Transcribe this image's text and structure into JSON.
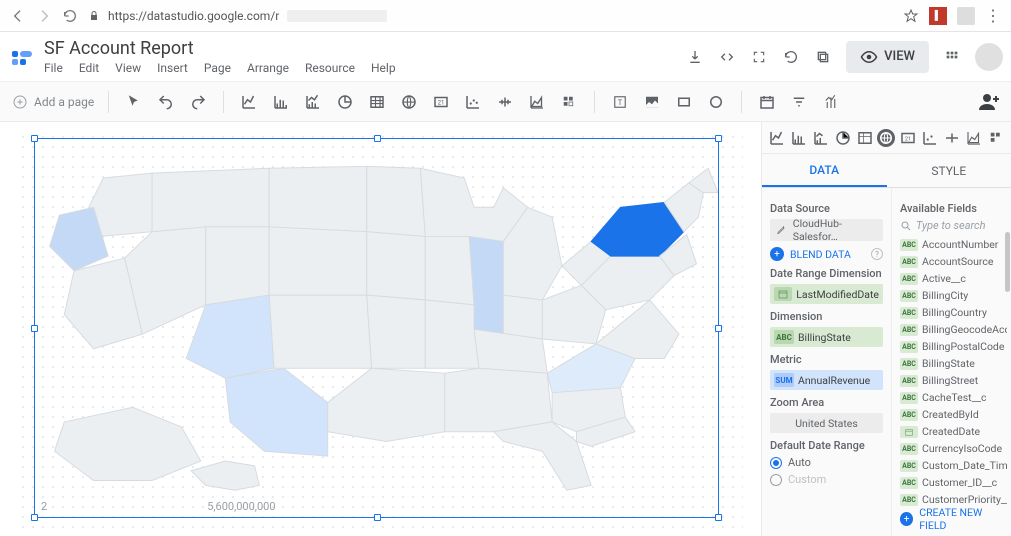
{
  "browser": {
    "url": "https://datastudio.google.com/r"
  },
  "header": {
    "title": "SF Account Report",
    "menus": [
      "File",
      "Edit",
      "View",
      "Insert",
      "Page",
      "Arrange",
      "Resource",
      "Help"
    ],
    "view_label": "VIEW"
  },
  "toolbar": {
    "add_page": "Add a page"
  },
  "canvas": {
    "footer_left": "2",
    "footer_value": "5,600,000,000"
  },
  "panel": {
    "tabs": {
      "data": "DATA",
      "style": "STYLE"
    },
    "sections": {
      "data_source": "Data Source",
      "date_range_dim": "Date Range Dimension",
      "dimension": "Dimension",
      "metric": "Metric",
      "zoom_area": "Zoom Area",
      "default_date_range": "Default Date Range",
      "available_fields": "Available Fields"
    },
    "data_source_chip": "CloudHub-Salesfor…",
    "blend": "BLEND DATA",
    "date_range_chip": "LastModifiedDate",
    "dimension_chip": "BillingState",
    "metric_chip": "AnnualRevenue",
    "metric_badge": "SUM",
    "zoom_chip": "United States",
    "radio_auto": "Auto",
    "radio_custom": "Custom",
    "search_placeholder": "Type to search",
    "fields": [
      {
        "t": "abc",
        "n": "AccountNumber"
      },
      {
        "t": "abc",
        "n": "AccountSource"
      },
      {
        "t": "abc",
        "n": "Active__c"
      },
      {
        "t": "abc",
        "n": "BillingCity"
      },
      {
        "t": "abc",
        "n": "BillingCountry"
      },
      {
        "t": "abc",
        "n": "BillingGeocodeAccura…"
      },
      {
        "t": "abc",
        "n": "BillingPostalCode"
      },
      {
        "t": "abc",
        "n": "BillingState"
      },
      {
        "t": "abc",
        "n": "BillingStreet"
      },
      {
        "t": "abc",
        "n": "CacheTest__c"
      },
      {
        "t": "abc",
        "n": "CreatedById"
      },
      {
        "t": "cal",
        "n": "CreatedDate"
      },
      {
        "t": "abc",
        "n": "CurrencyIsoCode"
      },
      {
        "t": "abc",
        "n": "Custom_Date_Time__c"
      },
      {
        "t": "abc",
        "n": "Customer_ID__c"
      },
      {
        "t": "abc",
        "n": "CustomerPriority__c"
      }
    ],
    "create_field": "CREATE NEW FIELD"
  },
  "chart_data": {
    "type": "choropleth_map",
    "title": "",
    "region": "United States",
    "dimension": "BillingState",
    "metric": "AnnualRevenue",
    "aggregation": "SUM",
    "legend": {
      "min_label": "2",
      "max_label": "5,600,000,000"
    },
    "highlighted_states": [
      {
        "state": "NY",
        "shade": "dark"
      },
      {
        "state": "IL",
        "shade": "light"
      },
      {
        "state": "OR",
        "shade": "light"
      },
      {
        "state": "AZ",
        "shade": "light"
      },
      {
        "state": "TX",
        "shade": "light"
      },
      {
        "state": "NC",
        "shade": "light"
      }
    ]
  }
}
